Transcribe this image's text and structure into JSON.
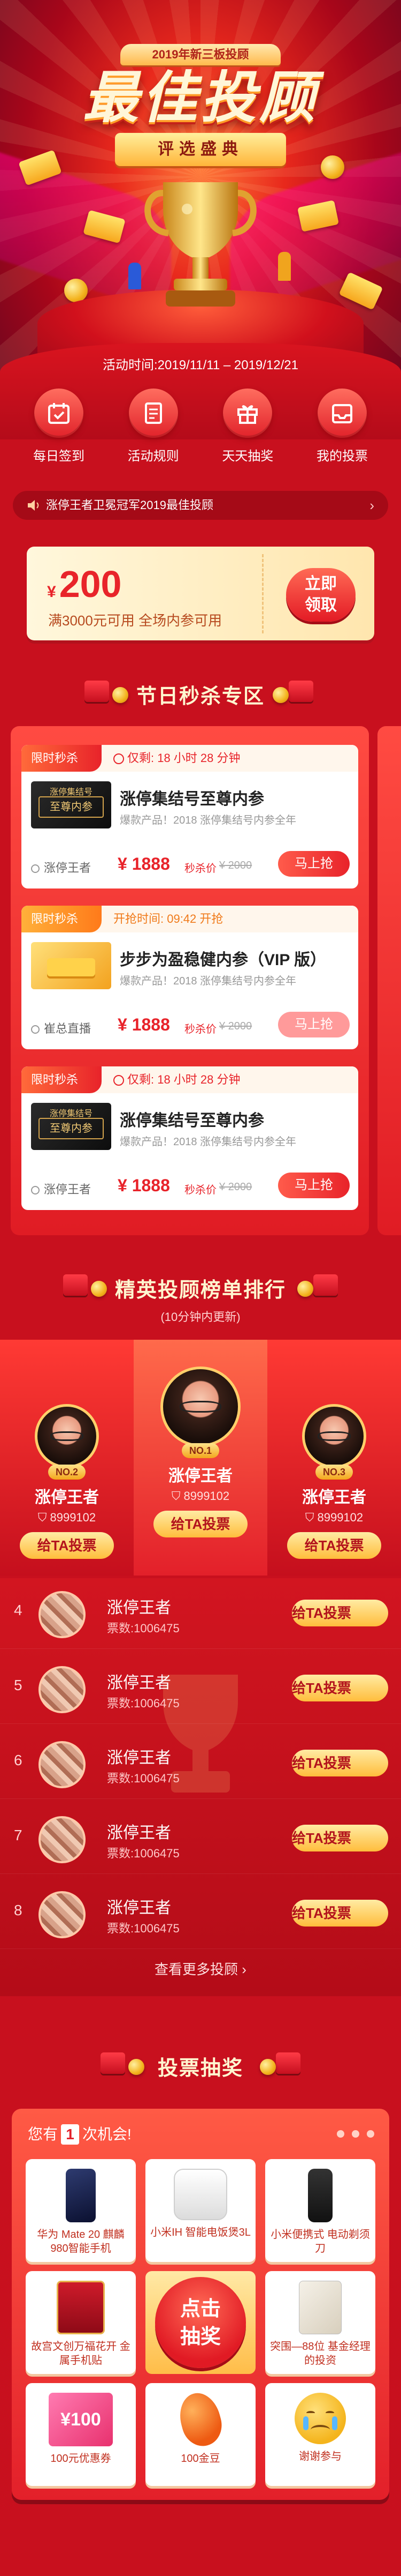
{
  "hero": {
    "year_badge": "2019年新三板投顾",
    "title": "最佳投顾",
    "subtitle": "评选盛典",
    "activity_time": "活动时间:2019/11/11 – 2019/12/21"
  },
  "quick_nav": [
    {
      "label": "每日签到",
      "icon": "calendar-icon"
    },
    {
      "label": "活动规则",
      "icon": "document-icon"
    },
    {
      "label": "天天抽奖",
      "icon": "gift-icon"
    },
    {
      "label": "我的投票",
      "icon": "inbox-icon"
    }
  ],
  "notice": {
    "text": "涨停王者卫冕冠军2019最佳投顾",
    "arrow": "›"
  },
  "coupon": {
    "currency": "¥",
    "amount": "200",
    "condition": "满3000元可用   全场内参可用",
    "button_line1": "立即",
    "button_line2": "领取"
  },
  "flash_sale": {
    "title": "节日秒杀专区",
    "items": [
      {
        "tag": "限时秒杀",
        "timer": "仅剩: 18 小时 28 分钟",
        "thumb_text": "至尊内参",
        "thumb_header": "涨停集结号",
        "title": "涨停集结号至尊内参",
        "desc": "爆款产品！2018 涨停集结号内参全年",
        "seller": "涨停王者",
        "price": "¥ 1888",
        "remain": "秒杀价",
        "original": "¥ 2000",
        "button": "马上抢",
        "style": "red"
      },
      {
        "tag": "限时秒杀",
        "timer": "开抢时间: 09:42 开抢",
        "thumb_text": "",
        "thumb_header": "",
        "title": "步步为盈稳健内参（VIP 版）",
        "desc": "爆款产品！2018 涨停集结号内参全年",
        "seller": "崔总直播",
        "price": "¥ 1888",
        "remain": "秒杀价",
        "original": "¥ 2000",
        "button": "马上抢",
        "style": "yellow"
      },
      {
        "tag": "限时秒杀",
        "timer": "仅剩: 18 小时 28 分钟",
        "thumb_text": "至尊内参",
        "thumb_header": "涨停集结号",
        "title": "涨停集结号至尊内参",
        "desc": "爆款产品！2018 涨停集结号内参全年",
        "seller": "涨停王者",
        "price": "¥ 1888",
        "remain": "秒杀价",
        "original": "¥ 2000",
        "button": "马上抢",
        "style": "red"
      }
    ]
  },
  "ranking": {
    "title": "精英投顾榜单排行",
    "subtitle": "(10分钟内更新)",
    "podium": [
      {
        "rank": "NO.2",
        "name": "涨停王者",
        "votes": "8999102",
        "button": "给TA投票"
      },
      {
        "rank": "NO.1",
        "name": "涨停王者",
        "votes": "8999102",
        "button": "给TA投票"
      },
      {
        "rank": "NO.3",
        "name": "涨停王者",
        "votes": "8999102",
        "button": "给TA投票"
      }
    ],
    "list": [
      {
        "num": "4",
        "name": "涨停王者",
        "votes": "票数:1006475",
        "button": "给TA投票"
      },
      {
        "num": "5",
        "name": "涨停王者",
        "votes": "票数:1006475",
        "button": "给TA投票"
      },
      {
        "num": "6",
        "name": "涨停王者",
        "votes": "票数:1006475",
        "button": "给TA投票"
      },
      {
        "num": "7",
        "name": "涨停王者",
        "votes": "票数:1006475",
        "button": "给TA投票"
      },
      {
        "num": "8",
        "name": "涨停王者",
        "votes": "票数:1006475",
        "button": "给TA投票"
      }
    ],
    "more": "查看更多投顾 ›"
  },
  "lottery": {
    "title": "投票抽奖",
    "chance_prefix": "您有",
    "chance_count": "1",
    "chance_suffix": "次机会!",
    "draw_line1": "点击",
    "draw_line2": "抽奖",
    "prizes": [
      {
        "label": "华为 Mate 20 麒麟980智能手机",
        "img": "phone-icon"
      },
      {
        "label": "小米IH 智能电饭煲3L",
        "img": "rice-cooker-icon"
      },
      {
        "label": "小米便携式 电动剃须刀",
        "img": "shaver-icon"
      },
      {
        "label": "故宫文创万福花开 金属手机贴",
        "img": "envelope-icon"
      },
      {
        "label": "突围—88位 基金经理的投资",
        "img": "book-icon"
      },
      {
        "label": "100元优惠券",
        "img": "coupon-icon",
        "badge": "¥100"
      },
      {
        "label": "100金豆",
        "img": "bean-icon"
      },
      {
        "label": "谢谢参与",
        "img": "crying-face-icon"
      }
    ]
  },
  "colors": {
    "primary_red": "#e8232a",
    "gold": "#ffbd3c",
    "background": "#c8101e"
  }
}
